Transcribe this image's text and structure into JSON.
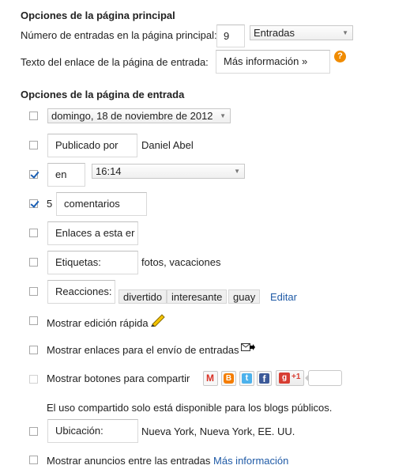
{
  "main_options": {
    "heading": "Opciones de la página principal",
    "posts_count_label": "Número de entradas en la página principal:",
    "posts_count_value": "9",
    "posts_unit": "Entradas",
    "link_text_label": "Texto del enlace de la página de entrada:",
    "link_text_value": "Más información »",
    "help_glyph": "?"
  },
  "post_options": {
    "heading": "Opciones de la página de entrada",
    "date_format": "domingo, 18 de noviembre de 2012",
    "posted_by_label": "Publicado por",
    "author": "Daniel Abel",
    "at_label": "en",
    "time_format": "16:14",
    "comments_prefix": "5",
    "comments_label": "comentarios",
    "backlinks_label": "Enlaces a esta er",
    "labels_label": "Etiquetas:",
    "labels_sample": "fotos, vacaciones",
    "reactions_label": "Reacciones:",
    "reactions": [
      "divertido",
      "interesante",
      "guay"
    ],
    "edit_link": "Editar",
    "quick_edit": "Mostrar edición rápida",
    "email_links": "Mostrar enlaces para el envío de entradas",
    "share_buttons": "Mostrar botones para compartir",
    "gplus_label": "+1",
    "share_note": "El uso compartido solo está disponible para los blogs públicos.",
    "location_label": "Ubicación:",
    "location_value": "Nueva York, Nueva York, EE. UU.",
    "ads_label": "Mostrar anuncios entre las entradas",
    "ads_more_link": "Más información"
  },
  "checkboxes": {
    "date": false,
    "posted_by": false,
    "time": true,
    "comments": true,
    "backlinks": false,
    "labels": false,
    "reactions": false,
    "quick_edit": false,
    "email_links": false,
    "share_buttons": false,
    "location": false,
    "ads": false
  },
  "colors": {
    "link": "#1f5aa6",
    "help": "#f08b00",
    "checkmark": "#1a5fb4"
  }
}
